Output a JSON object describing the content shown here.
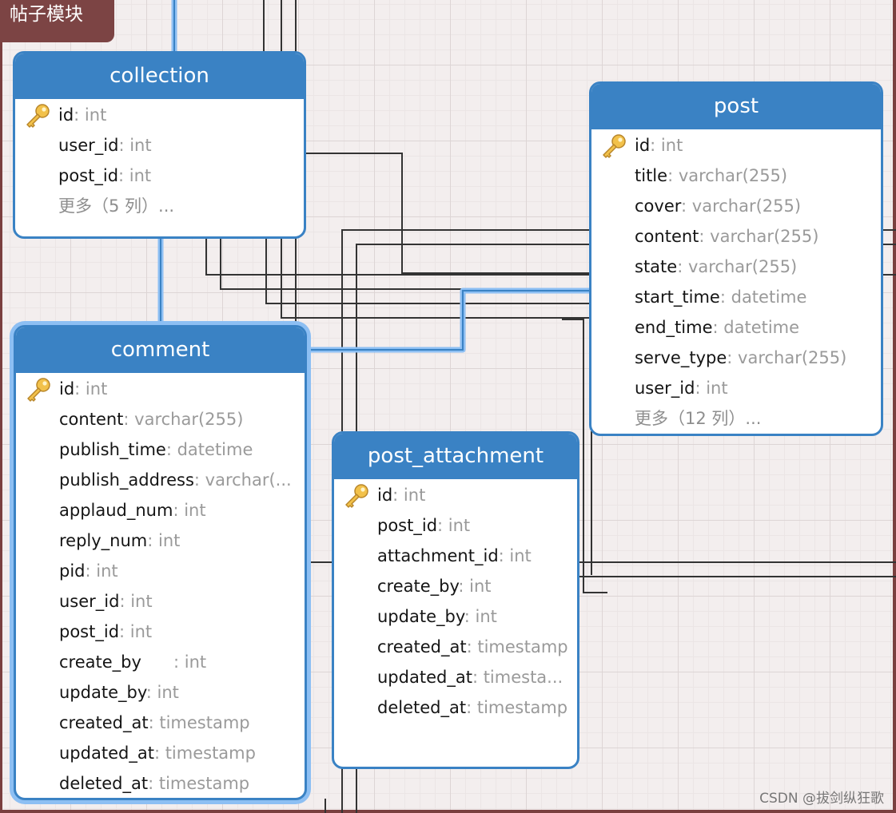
{
  "module": {
    "title": "帖子模块"
  },
  "entities": {
    "collection": {
      "name": "collection",
      "fields": [
        {
          "name": "id",
          "type": ": int",
          "key": true
        },
        {
          "name": "user_id",
          "type": ": int"
        },
        {
          "name": "post_id",
          "type": ": int"
        }
      ],
      "more": "更多（5 列）..."
    },
    "comment": {
      "name": "comment",
      "fields": [
        {
          "name": "id",
          "type": ": int",
          "key": true
        },
        {
          "name": "content",
          "type": ": varchar(255)"
        },
        {
          "name": "publish_time",
          "type": ": datetime"
        },
        {
          "name": "publish_address",
          "type": ": varchar(..."
        },
        {
          "name": "applaud_num",
          "type": ": int"
        },
        {
          "name": "reply_num",
          "type": ": int"
        },
        {
          "name": "pid",
          "type": ": int"
        },
        {
          "name": "user_id",
          "type": ": int"
        },
        {
          "name": "post_id",
          "type": ": int"
        },
        {
          "name": "create_by      ",
          "type": ": int"
        },
        {
          "name": "update_by",
          "type": ": int"
        },
        {
          "name": "created_at",
          "type": ": timestamp"
        },
        {
          "name": "updated_at",
          "type": ": timestamp"
        },
        {
          "name": "deleted_at",
          "type": ": timestamp"
        }
      ]
    },
    "post": {
      "name": "post",
      "fields": [
        {
          "name": "id",
          "type": ": int",
          "key": true
        },
        {
          "name": "title",
          "type": ": varchar(255)"
        },
        {
          "name": "cover",
          "type": ": varchar(255)"
        },
        {
          "name": "content",
          "type": ": varchar(255)"
        },
        {
          "name": "state",
          "type": ": varchar(255)"
        },
        {
          "name": "start_time",
          "type": ": datetime"
        },
        {
          "name": "end_time",
          "type": ": datetime"
        },
        {
          "name": "serve_type",
          "type": ": varchar(255)"
        },
        {
          "name": "user_id",
          "type": ": int"
        }
      ],
      "more": "更多（12 列）..."
    },
    "post_attachment": {
      "name": "post_attachment",
      "fields": [
        {
          "name": "id",
          "type": ": int",
          "key": true
        },
        {
          "name": "post_id",
          "type": ": int"
        },
        {
          "name": "attachment_id",
          "type": ": int"
        },
        {
          "name": "create_by",
          "type": ": int"
        },
        {
          "name": "update_by",
          "type": ": int"
        },
        {
          "name": "created_at",
          "type": ": timestamp"
        },
        {
          "name": "updated_at",
          "type": ": timesta..."
        },
        {
          "name": "deleted_at",
          "type": ": timestamp"
        }
      ]
    }
  },
  "watermark": "CSDN @拔剑纵狂歌",
  "colors": {
    "header": "#3a82c4",
    "module": "#7c4444",
    "highlight": "#8dbff3"
  }
}
